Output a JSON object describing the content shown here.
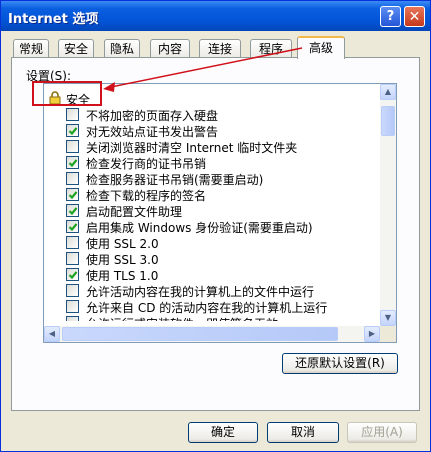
{
  "window": {
    "title": "Internet 选项"
  },
  "tabs": [
    {
      "label": "常规",
      "active": false
    },
    {
      "label": "安全",
      "active": false
    },
    {
      "label": "隐私",
      "active": false
    },
    {
      "label": "内容",
      "active": false
    },
    {
      "label": "连接",
      "active": false
    },
    {
      "label": "程序",
      "active": false
    },
    {
      "label": "高级",
      "active": true
    }
  ],
  "settings": {
    "label": "设置(S):",
    "group": {
      "label": "安全",
      "icon": "lock-icon"
    },
    "items": [
      {
        "label": "不将加密的页面存入硬盘",
        "checked": false
      },
      {
        "label": "对无效站点证书发出警告",
        "checked": true
      },
      {
        "label": "关闭浏览器时清空 Internet 临时文件夹",
        "checked": false
      },
      {
        "label": "检查发行商的证书吊销",
        "checked": true
      },
      {
        "label": "检查服务器证书吊销(需要重启动)",
        "checked": false
      },
      {
        "label": "检查下载的程序的签名",
        "checked": true
      },
      {
        "label": "启动配置文件助理",
        "checked": true
      },
      {
        "label": "启用集成 Windows 身份验证(需要重启动)",
        "checked": true
      },
      {
        "label": "使用 SSL 2.0",
        "checked": false
      },
      {
        "label": "使用 SSL 3.0",
        "checked": false
      },
      {
        "label": "使用 TLS 1.0",
        "checked": true
      },
      {
        "label": "允许活动内容在我的计算机上的文件中运行",
        "checked": false
      },
      {
        "label": "允许来自 CD 的活动内容在我的计算机上运行",
        "checked": false
      },
      {
        "label": "允许运行或安装软件，即使签名无效",
        "checked": false
      }
    ]
  },
  "buttons": {
    "restore_defaults": "还原默认设置(R)",
    "ok": "确定",
    "cancel": "取消",
    "apply": "应用(A)"
  },
  "title_buttons": {
    "help": "?",
    "close": "✕"
  },
  "colors": {
    "titlebar": "#0353d6",
    "highlight": "#d0101a",
    "check": "#21a121"
  }
}
